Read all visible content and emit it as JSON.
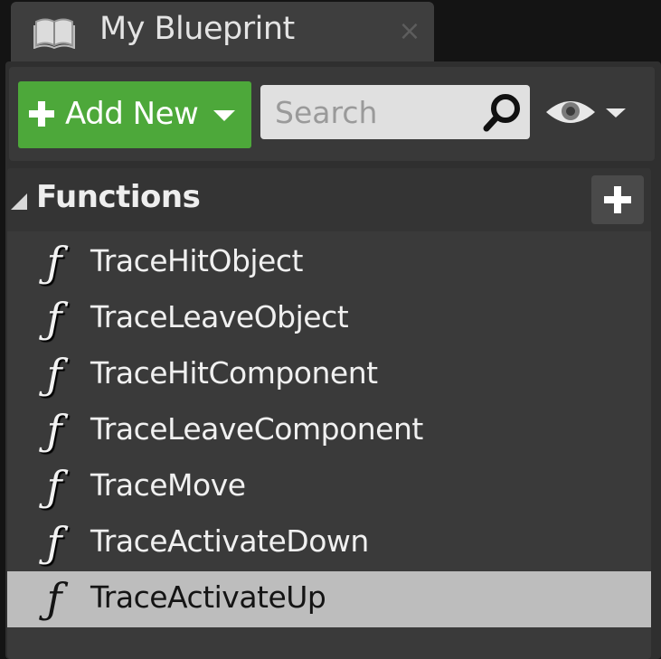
{
  "tab": {
    "title": "My Blueprint",
    "close_glyph": "×",
    "icon": "book-icon"
  },
  "toolbar": {
    "add_new_label": "Add New",
    "add_new_icon": "plus-icon",
    "add_new_dropdown_icon": "caret-down-icon",
    "search_placeholder": "Search",
    "search_value": "",
    "search_icon": "magnifier-icon",
    "view_options_icon": "eye-icon"
  },
  "functions": {
    "title": "Functions",
    "collapse_icon": "triangle-expanded-icon",
    "add_icon": "plus-icon",
    "item_icon_glyph": "ƒ",
    "items": [
      {
        "label": "TraceHitObject",
        "selected": false
      },
      {
        "label": "TraceLeaveObject",
        "selected": false
      },
      {
        "label": "TraceHitComponent",
        "selected": false
      },
      {
        "label": "TraceLeaveComponent",
        "selected": false
      },
      {
        "label": "TraceMove",
        "selected": false
      },
      {
        "label": "TraceActivateDown",
        "selected": false
      },
      {
        "label": "TraceActivateUp",
        "selected": true
      }
    ]
  },
  "colors": {
    "add_new_bg": "#4da83a",
    "selected_row_bg": "#bdbdbd",
    "panel_bg": "#2f2f2f"
  }
}
